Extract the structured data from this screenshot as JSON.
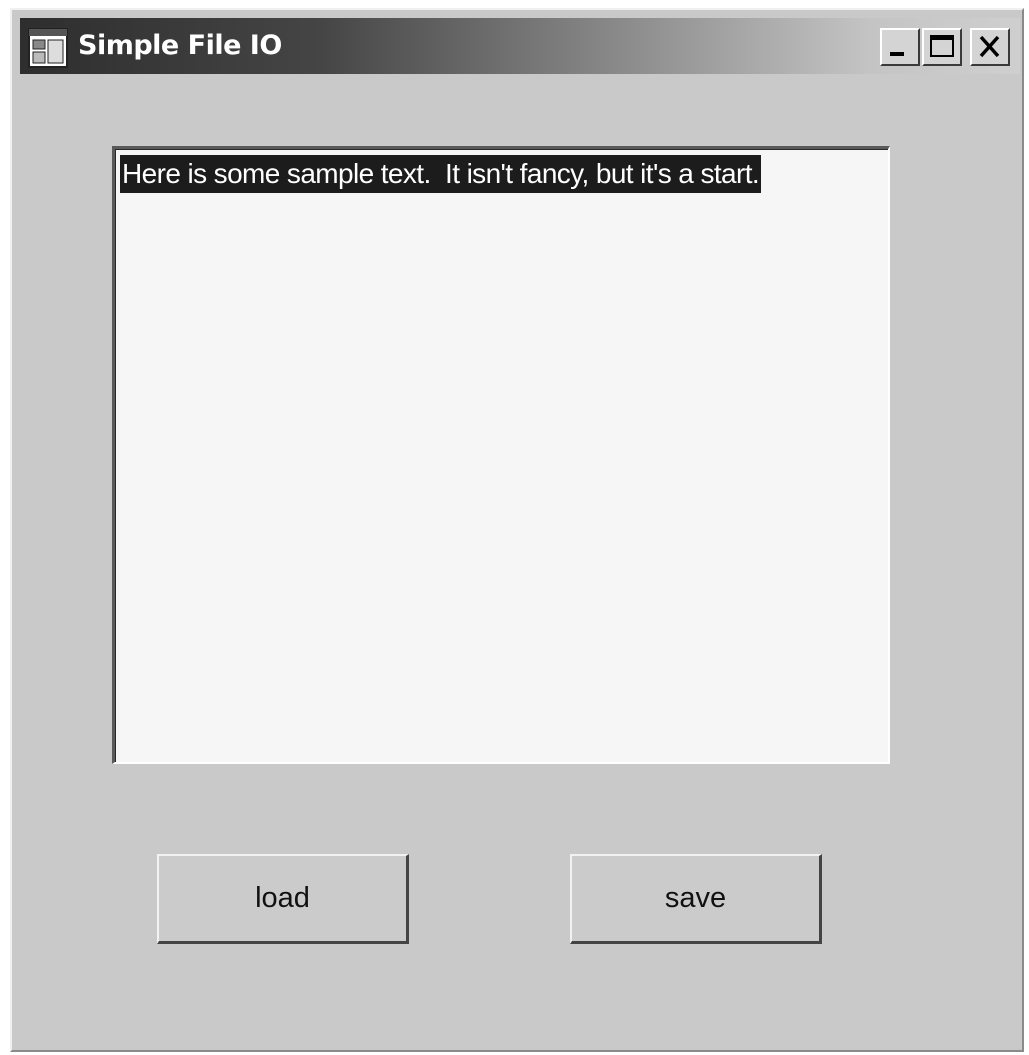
{
  "window": {
    "title": "Simple File IO",
    "icon": "app-window-icon",
    "controls": {
      "minimize": "minimize-icon",
      "maximize": "maximize-icon",
      "close": "close-icon"
    }
  },
  "textbox": {
    "content": "Here is some sample text.  It isn't fancy, but it's a start.",
    "selected": true
  },
  "buttons": {
    "load_label": "load",
    "save_label": "save"
  },
  "colors": {
    "window_background": "#c9c9c9",
    "textbox_background": "#f6f6f6",
    "selection_background": "#1c1c1c",
    "selection_text": "#ffffff"
  }
}
